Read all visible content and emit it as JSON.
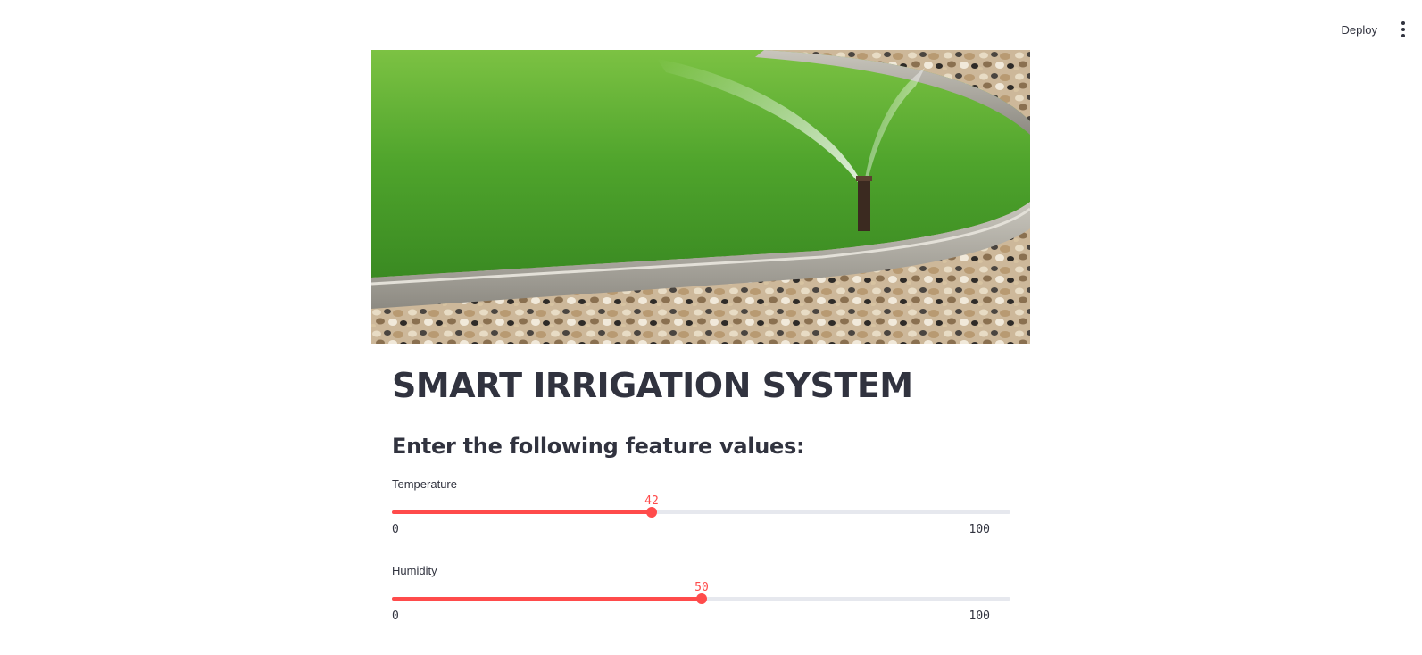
{
  "toolbar": {
    "deploy_label": "Deploy",
    "menu_icon": "vertical-ellipsis-icon"
  },
  "hero_image": {
    "subject": "lawn sprinkler spraying water over green grass beside a concrete curb and pebbles"
  },
  "title": "SMART IRRIGATION SYSTEM",
  "subtitle": "Enter the following feature values:",
  "sliders": [
    {
      "label": "Temperature",
      "value": "42",
      "min": "0",
      "max": "100",
      "fraction": 0.42
    },
    {
      "label": "Humidity",
      "value": "50",
      "min": "0",
      "max": "100",
      "fraction": 0.5
    }
  ],
  "colors": {
    "accent": "#ff4b4b",
    "track": "#e6e8ee",
    "text": "#31333f"
  }
}
